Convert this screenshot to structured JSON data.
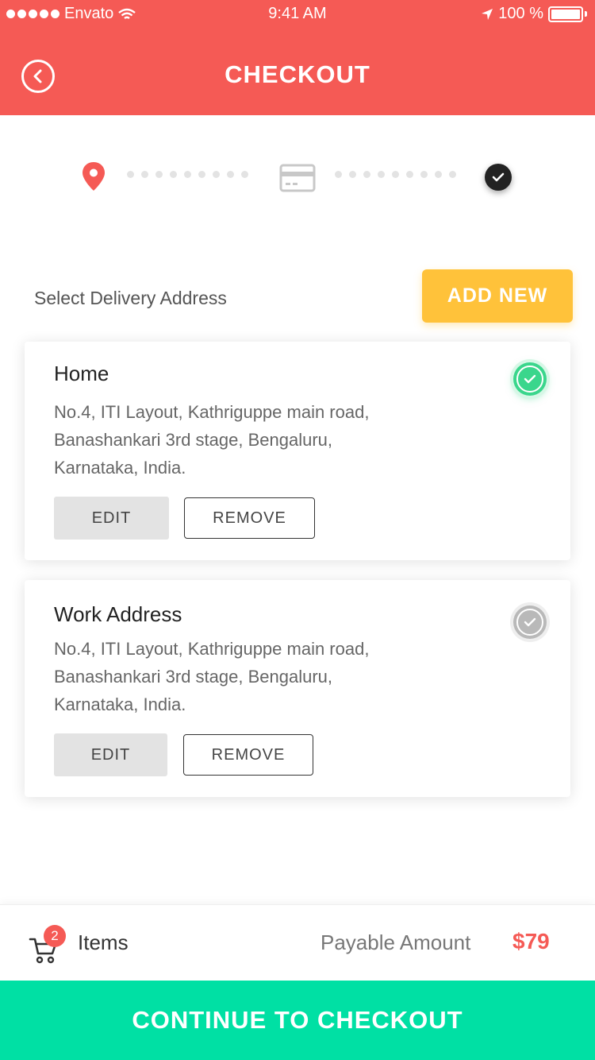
{
  "status_bar": {
    "carrier": "Envato",
    "time": "9:41 AM",
    "battery": "100 %"
  },
  "header": {
    "title": "CHECKOUT"
  },
  "stepper": {
    "steps": [
      "location",
      "payment",
      "confirm"
    ]
  },
  "section": {
    "label": "Select Delivery Address",
    "add_button": "ADD NEW"
  },
  "addresses": [
    {
      "name": "Home",
      "line1": "No.4, ITI Layout, Kathriguppe main road,",
      "line2": "Banashankari 3rd stage, Bengaluru,",
      "line3": "Karnataka, India.",
      "selected": true,
      "edit_label": "EDIT",
      "remove_label": "REMOVE"
    },
    {
      "name": "Work Address",
      "line1": "No.4, ITI Layout, Kathriguppe main road,",
      "line2": "Banashankari 3rd stage, Bengaluru,",
      "line3": "Karnataka, India.",
      "selected": false,
      "edit_label": "EDIT",
      "remove_label": "REMOVE"
    }
  ],
  "summary": {
    "cart_count": "2",
    "items_label": "Items",
    "payable_label": "Payable Amount",
    "payable_value": "$79"
  },
  "cta": {
    "label": "CONTINUE TO CHECKOUT"
  },
  "colors": {
    "primary": "#f55a55",
    "accent": "#ffc23a",
    "success": "#3ad68c",
    "cta": "#00e0a4"
  }
}
